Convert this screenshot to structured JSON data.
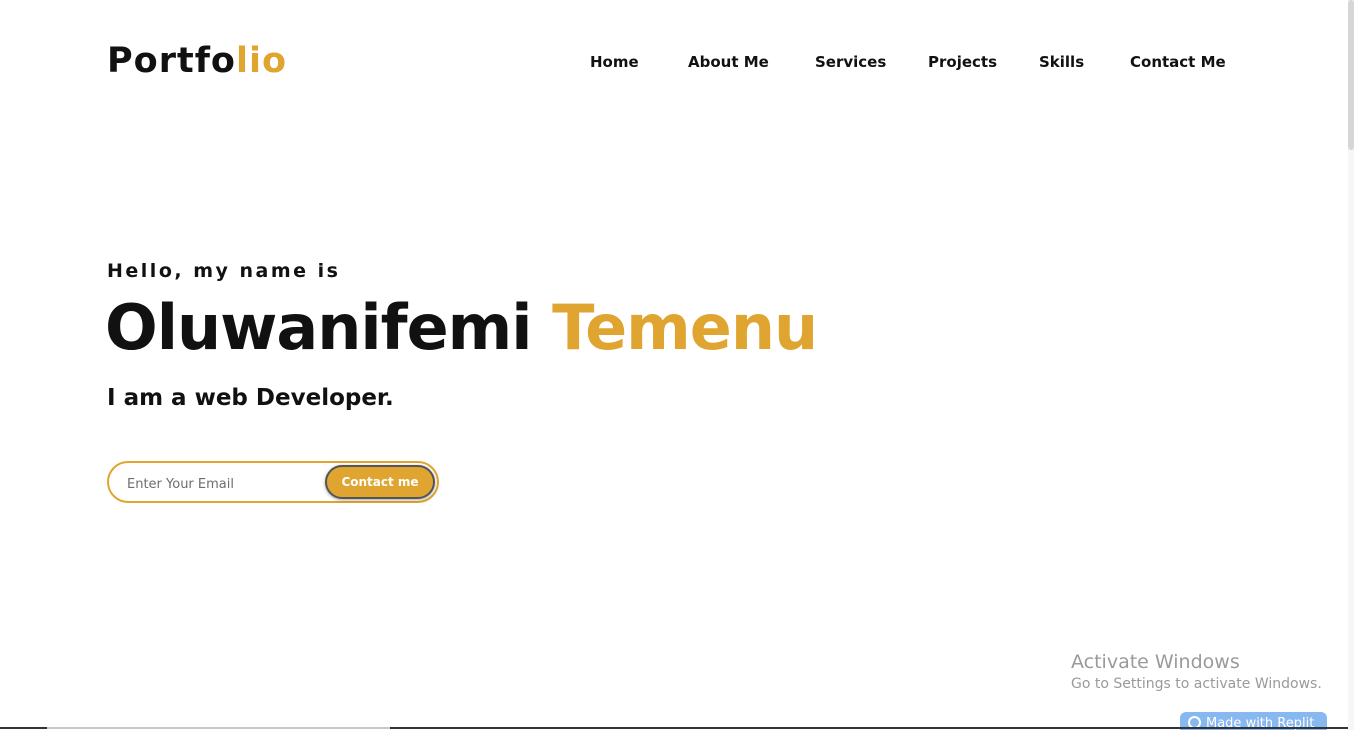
{
  "header": {
    "logo_main": "Portfo",
    "logo_accent": "lio",
    "nav": [
      {
        "label": "Home"
      },
      {
        "label": "About Me"
      },
      {
        "label": "Services"
      },
      {
        "label": "Projects"
      },
      {
        "label": "Skills"
      },
      {
        "label": "Contact Me"
      }
    ]
  },
  "hero": {
    "greeting": "Hello, my name is",
    "first_name": "Oluwanifemi",
    "last_name": "Temenu",
    "role": "I am a web Developer.",
    "email_placeholder": "Enter Your Email",
    "email_value": "",
    "contact_button": "Contact me"
  },
  "watermark": {
    "title": "Activate Windows",
    "subtitle": "Go to Settings to activate Windows."
  },
  "badge": {
    "label": "Made with Replit",
    "icon": "replit-icon"
  },
  "colors": {
    "accent": "#E0A530",
    "text": "#111111",
    "background": "#ffffff"
  }
}
